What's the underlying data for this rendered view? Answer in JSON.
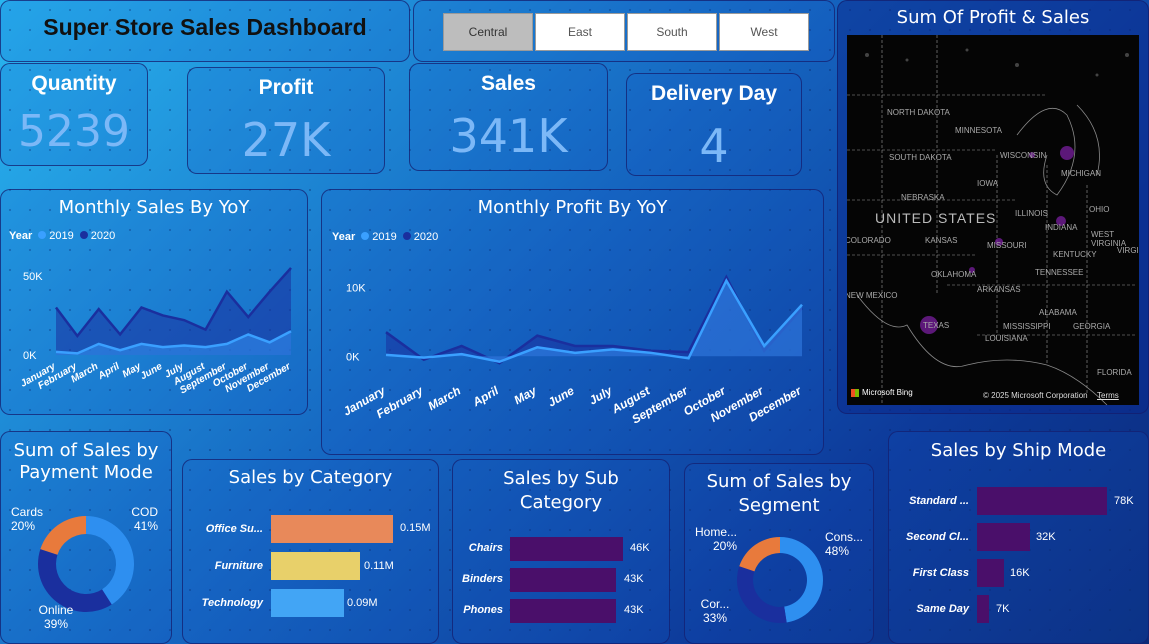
{
  "header": {
    "title": "Super Store Sales Dashboard"
  },
  "slicer": {
    "regions": [
      "Central",
      "East",
      "South",
      "West"
    ],
    "selected": "Central"
  },
  "kpis": {
    "quantity": {
      "label": "Quantity",
      "value": "5239"
    },
    "profit": {
      "label": "Profit",
      "value": "27K"
    },
    "sales": {
      "label": "Sales",
      "value": "341K"
    },
    "delivery": {
      "label": "Delivery Day",
      "value": "4"
    }
  },
  "map": {
    "title": "Sum Of Profit & Sales",
    "country_label": "UNITED STATES",
    "state_labels": [
      "NORTH DAKOTA",
      "MINNESOTA",
      "SOUTH DAKOTA",
      "WISCONSIN",
      "MICHIGAN",
      "IOWA",
      "NEBRASKA",
      "ILLINOIS",
      "INDIANA",
      "OHIO",
      "COLORADO",
      "KANSAS",
      "MISSOURI",
      "WEST VIRGINIA",
      "KENTUCKY",
      "OKLAHOMA",
      "TENNESSEE",
      "NEW MEXICO",
      "ARKANSAS",
      "VIRGINIA",
      "TEXAS",
      "MISSISSIPPI",
      "ALABAMA",
      "GEORGIA",
      "LOUISIANA",
      "FLORIDA"
    ],
    "bing_label": "Microsoft Bing",
    "copyright": "© 2025 Microsoft Corporation",
    "terms": "Terms"
  },
  "monthly_sales": {
    "title": "Monthly Sales By YoY",
    "legend_title": "Year",
    "series_names": [
      "2019",
      "2020"
    ],
    "colors": {
      "2019": "#3aa0ff",
      "2020": "#1a2f9e"
    },
    "chart_data": {
      "type": "area",
      "categories": [
        "January",
        "February",
        "March",
        "April",
        "May",
        "June",
        "July",
        "August",
        "September",
        "October",
        "November",
        "December"
      ],
      "series": [
        {
          "name": "2019",
          "values": [
            2,
            1,
            7,
            3,
            7,
            5,
            6,
            5,
            7,
            13,
            8,
            15
          ]
        },
        {
          "name": "2020",
          "values": [
            30,
            12,
            29,
            13,
            30,
            25,
            22,
            16,
            40,
            24,
            40,
            55
          ]
        }
      ],
      "y_ticks": [
        "50K",
        "0K"
      ],
      "ylim": [
        0,
        60
      ]
    }
  },
  "monthly_profit": {
    "title": "Monthly Profit By YoY",
    "legend_title": "Year",
    "series_names": [
      "2019",
      "2020"
    ],
    "colors": {
      "2019": "#3aa0ff",
      "2020": "#1a2f9e"
    },
    "chart_data": {
      "type": "area",
      "categories": [
        "January",
        "February",
        "March",
        "April",
        "May",
        "June",
        "July",
        "August",
        "September",
        "October",
        "November",
        "December"
      ],
      "series": [
        {
          "name": "2019",
          "values": [
            0.2,
            -0.2,
            0.3,
            -0.8,
            1.3,
            0.5,
            1,
            0.5,
            -0.3,
            11,
            1.5,
            7.5
          ]
        },
        {
          "name": "2020",
          "values": [
            3.5,
            -0.5,
            1.5,
            -1,
            3,
            1.5,
            1.5,
            0.8,
            0.6,
            11.5,
            0.8,
            7
          ]
        }
      ],
      "y_ticks": [
        "10K",
        "0K"
      ],
      "ylim": [
        -2,
        14
      ]
    }
  },
  "payment": {
    "title": "Sum of Sales by Payment Mode",
    "chart_data": {
      "type": "pie",
      "labels": [
        "COD",
        "Online",
        "Cards"
      ],
      "values": [
        41,
        39,
        20
      ],
      "colors": [
        "#2e8ff0",
        "#1a2f9e",
        "#e87a3c"
      ],
      "display": [
        "41%",
        "39%",
        "20%"
      ]
    }
  },
  "category": {
    "title": "Sales by Category",
    "chart_data": {
      "type": "bar",
      "categories": [
        "Office Su...",
        "Furniture",
        "Technology"
      ],
      "values": [
        0.15,
        0.11,
        0.09
      ],
      "display": [
        "0.15M",
        "0.11M",
        "0.09M"
      ],
      "colors": [
        "#e8895a",
        "#e8d06a",
        "#42a5f5"
      ]
    }
  },
  "subcategory": {
    "title": "Sales by Sub Category",
    "chart_data": {
      "type": "bar",
      "categories": [
        "Chairs",
        "Binders",
        "Phones"
      ],
      "values": [
        46,
        43,
        43
      ],
      "display": [
        "46K",
        "43K",
        "43K"
      ],
      "color": "#4a0f6a"
    }
  },
  "segment": {
    "title": "Sum of Sales by Segment",
    "chart_data": {
      "type": "pie",
      "labels": [
        "Cons...",
        "Cor...",
        "Home..."
      ],
      "values": [
        48,
        33,
        20
      ],
      "colors": [
        "#2e8ff0",
        "#1a2f9e",
        "#e87a3c"
      ],
      "display": [
        "48%",
        "33%",
        "20%"
      ]
    }
  },
  "shipmode": {
    "title": "Sales by Ship Mode",
    "chart_data": {
      "type": "bar",
      "categories": [
        "Standard ...",
        "Second Cl...",
        "First Class",
        "Same Day"
      ],
      "values": [
        78,
        32,
        16,
        7
      ],
      "display": [
        "78K",
        "32K",
        "16K",
        "7K"
      ],
      "color": "#4a0f6a"
    }
  }
}
